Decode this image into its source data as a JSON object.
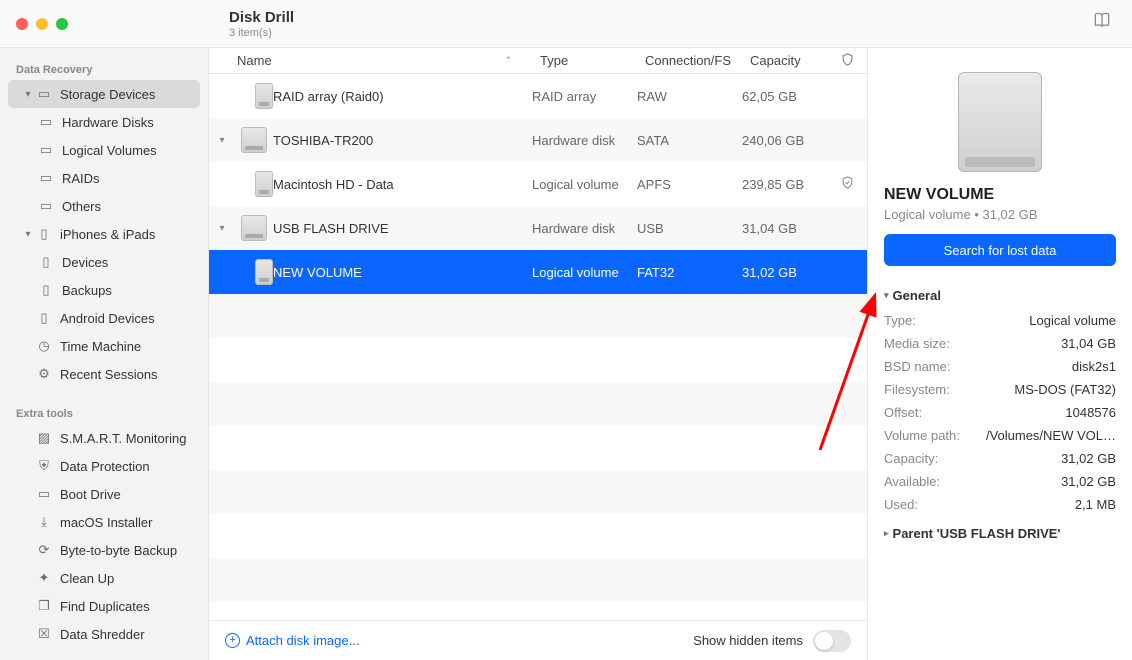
{
  "header": {
    "app_title": "Disk Drill",
    "subtitle": "3 item(s)"
  },
  "sidebar": {
    "section1_label": "Data Recovery",
    "storage_devices": "Storage Devices",
    "hardware_disks": "Hardware Disks",
    "logical_volumes": "Logical Volumes",
    "raids": "RAIDs",
    "others": "Others",
    "iphones_ipads": "iPhones & iPads",
    "devices": "Devices",
    "backups": "Backups",
    "android": "Android Devices",
    "time_machine": "Time Machine",
    "recent_sessions": "Recent Sessions",
    "section2_label": "Extra tools",
    "smart": "S.M.A.R.T. Monitoring",
    "data_protection": "Data Protection",
    "boot_drive": "Boot Drive",
    "macos_installer": "macOS Installer",
    "byte_backup": "Byte-to-byte Backup",
    "clean_up": "Clean Up",
    "find_duplicates": "Find Duplicates",
    "data_shredder": "Data Shredder"
  },
  "columns": {
    "name": "Name",
    "type": "Type",
    "conn": "Connection/FS",
    "capacity": "Capacity"
  },
  "rows": [
    {
      "name": "RAID array (Raid0)",
      "type": "RAID array",
      "conn": "RAW",
      "cap": "62,05 GB",
      "indent": true,
      "disclosure": "",
      "shield": ""
    },
    {
      "name": "TOSHIBA-TR200",
      "type": "Hardware disk",
      "conn": "SATA",
      "cap": "240,06 GB",
      "indent": false,
      "disclosure": "▾",
      "shield": ""
    },
    {
      "name": "Macintosh HD - Data",
      "type": "Logical volume",
      "conn": "APFS",
      "cap": "239,85 GB",
      "indent": true,
      "disclosure": "",
      "shield": "✓"
    },
    {
      "name": "USB FLASH DRIVE",
      "type": "Hardware disk",
      "conn": "USB",
      "cap": "31,04 GB",
      "indent": false,
      "disclosure": "▾",
      "shield": ""
    },
    {
      "name": "NEW VOLUME",
      "type": "Logical volume",
      "conn": "FAT32",
      "cap": "31,02 GB",
      "indent": true,
      "disclosure": "",
      "shield": "",
      "selected": true
    }
  ],
  "footer": {
    "attach": "Attach disk image...",
    "hidden": "Show hidden items"
  },
  "details": {
    "title": "NEW VOLUME",
    "subtitle": "Logical volume • 31,02 GB",
    "button": "Search for lost data",
    "general_label": "General",
    "kv": [
      {
        "k": "Type:",
        "v": "Logical volume"
      },
      {
        "k": "Media size:",
        "v": "31,04 GB"
      },
      {
        "k": "BSD name:",
        "v": "disk2s1"
      },
      {
        "k": "Filesystem:",
        "v": "MS-DOS (FAT32)"
      },
      {
        "k": "Offset:",
        "v": "1048576"
      },
      {
        "k": "Volume path:",
        "v": "/Volumes/NEW VOL…"
      },
      {
        "k": "Capacity:",
        "v": "31,02 GB"
      },
      {
        "k": "Available:",
        "v": "31,02 GB"
      },
      {
        "k": "Used:",
        "v": "2,1 MB"
      }
    ],
    "parent_label": "Parent 'USB FLASH DRIVE'"
  }
}
